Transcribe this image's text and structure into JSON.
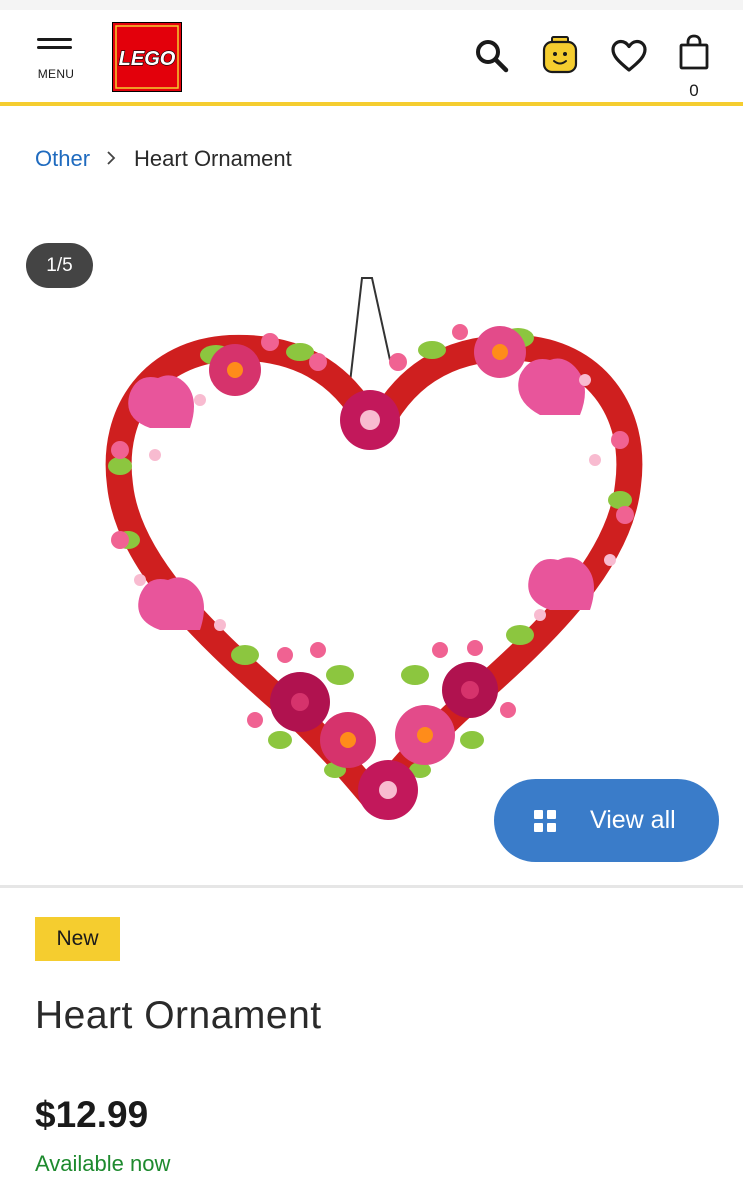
{
  "header": {
    "menu_label": "MENU",
    "logo_text": "LEGO",
    "cart_count": "0"
  },
  "breadcrumb": {
    "parent": "Other",
    "current": "Heart Ornament"
  },
  "gallery": {
    "counter": "1/5",
    "view_all_label": "View all"
  },
  "product": {
    "badge": "New",
    "title": "Heart Ornament",
    "price": "$12.99",
    "availability": "Available now"
  },
  "colors": {
    "accent_yellow": "#f5cd2f",
    "link_blue": "#1f6bbf",
    "button_blue": "#3a7cc9",
    "available_green": "#1e8a2e",
    "lego_red": "#e3000b"
  },
  "icons": [
    "menu-icon",
    "lego-logo",
    "search-icon",
    "account-icon",
    "heart-icon",
    "bag-icon",
    "chevron-right-icon",
    "grid-icon"
  ]
}
